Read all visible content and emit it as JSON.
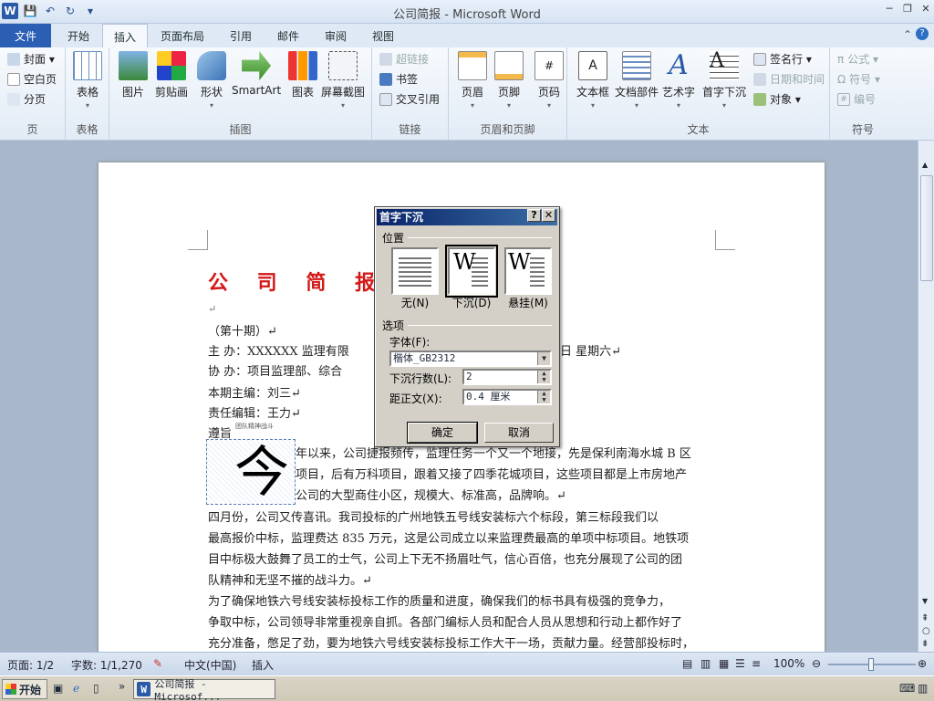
{
  "window": {
    "title": "公司简报 - Microsoft Word"
  },
  "qat": {
    "logo": "W",
    "save": "💾",
    "undo": "↶",
    "redo": "↻",
    "more": "▾"
  },
  "window_controls": {
    "minimize": "─",
    "restore": "❐",
    "close": "✕"
  },
  "tabs": [
    "文件",
    "开始",
    "插入",
    "页面布局",
    "引用",
    "邮件",
    "审阅",
    "视图"
  ],
  "ribbon": {
    "pages": {
      "label": "页",
      "items": [
        "封面 ▾",
        "空白页",
        "分页"
      ]
    },
    "tables": {
      "label": "表格",
      "btn": "表格"
    },
    "illustrations": {
      "label": "插图",
      "items": [
        "图片",
        "剪贴画",
        "形状",
        "SmartArt",
        "图表",
        "屏幕截图"
      ]
    },
    "links": {
      "label": "链接",
      "items": [
        "超链接",
        "书签",
        "交叉引用"
      ]
    },
    "header_footer": {
      "label": "页眉和页脚",
      "items": [
        "页眉",
        "页脚",
        "页码"
      ]
    },
    "text": {
      "label": "文本",
      "items": [
        "文本框",
        "文档部件",
        "艺术字",
        "首字下沉"
      ],
      "small": [
        "签名行 ▾",
        "日期和时间",
        "对象 ▾"
      ]
    },
    "symbols": {
      "label": "符号",
      "items": [
        "公式 ▾",
        "符号 ▾",
        "编号"
      ]
    }
  },
  "document": {
    "title": "公 司 简 报",
    "lines": [
      "↵",
      "（第十期）↵",
      "主      办：XXXXXX 监理有限",
      "协      办：项目监理部、综合",
      "本期主编：刘三↵",
      "责任编辑：王力↵",
      "遵旨"
    ],
    "date_tail": "日      星期六↵",
    "tiny_note": "团队精神战斗",
    "dropcap": "今",
    "para1": [
      "年以来，公司捷报频传，监理任务一个又一个地接，先是保利南海水城 B 区",
      "项目，后有万科项目，跟着又接了四季花城项目，这些项目都是上市房地产",
      "公司的大型商住小区，规模大、标准高，品牌响。↵"
    ],
    "para2": [
      "        四月份，公司又传喜讯。我司投标的广州地铁五号线安装标六个标段，第三标段我们以",
      "最高报价中标，监理费达 835 万元，这是公司成立以来监理费最高的单项中标项目。地铁项",
      "目中标极大鼓舞了员工的士气，公司上下无不扬眉吐气，信心百倍，也充分展现了公司的团",
      "队精神和无坚不摧的战斗力。↵"
    ],
    "para3": [
      "        为了确保地铁六号线安装标投标工作的质量和进度，确保我们的标书具有极强的竞争力，",
      "争取中标，公司领导非常重视亲自抓。各部门编标人员和配合人员从思想和行动上都作好了",
      "充分准备，憋足了劲，要为地铁六号线安装标投标工作大干一场，贡献力量。经营部投标时，"
    ]
  },
  "dialog": {
    "title": "首字下沉",
    "help": "?",
    "close": "✕",
    "position_label": "位置",
    "options": [
      "无(N)",
      "下沉(D)",
      "悬挂(M)"
    ],
    "options_section": "选项",
    "font_label": "字体(F):",
    "font_value": "楷体_GB2312",
    "lines_label": "下沉行数(L):",
    "lines_value": "2",
    "distance_label": "距正文(X):",
    "distance_value": "0.4 厘米",
    "ok": "确定",
    "cancel": "取消"
  },
  "status": {
    "page": "页面: 1/2",
    "words": "字数: 1/1,270",
    "lang": "中文(中国)",
    "mode": "插入",
    "zoom": "100%"
  },
  "taskbar": {
    "start": "开始",
    "task": "公司简报 - Microsof..."
  },
  "colors": {
    "title_red": "#d41818",
    "file_tab": "#2b5fb4",
    "dialog_title": "#0a246a"
  }
}
